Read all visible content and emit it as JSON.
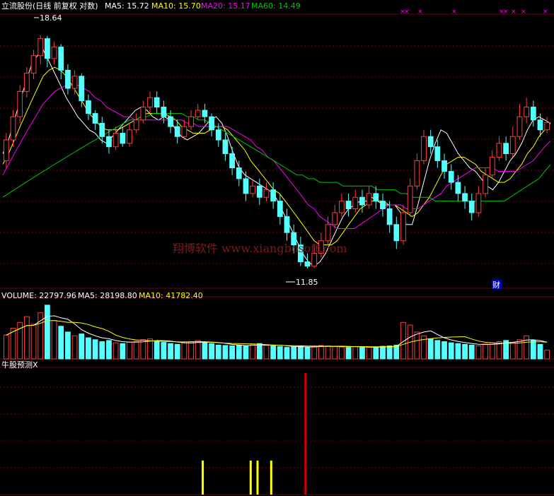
{
  "header_main": {
    "title": "立流股份(日线 前复权 对数)",
    "ma5_label": "MA5: 15.72",
    "ma10_label": "MA10: 15.70",
    "ma20_label": "MA20: 15.17",
    "ma60_label": "MA60: 14.49"
  },
  "annotations": {
    "high_marker": "18.64",
    "low_marker": "11.85",
    "cai_badge": "财",
    "watermark": "翔博软件 www.xiangbosoft.com",
    "x_marks": [
      "×",
      "×",
      "×",
      "×",
      "×",
      "×",
      "×",
      "×",
      "×"
    ]
  },
  "header_volume": {
    "volume_label": "VOLUME: 22797.96",
    "ma5_label": "MA5: 28198.80",
    "ma10_label": "MA10: 41782.40"
  },
  "header_indicator": {
    "title": "牛股预测X"
  },
  "colors": {
    "up": "#ff3c3c",
    "down": "#54ffff",
    "ma5": "#ffffff",
    "ma10": "#ffff00",
    "ma20": "#ff00ff",
    "ma60": "#00c800",
    "grid": "#7a0000",
    "signal_yellow": "#ffff00",
    "signal_red": "#c80000"
  },
  "chart_data": [
    {
      "type": "candlestick",
      "title": "立流股份(日线 前复权 对数)",
      "y_scale": "log",
      "ylim": [
        11.4,
        19.4
      ],
      "max_marker": 18.64,
      "min_marker": 11.85,
      "ma_latest": {
        "MA5": 15.72,
        "MA10": 15.7,
        "MA20": 15.17,
        "MA60": 14.49
      },
      "series": [
        {
          "name": "MA5",
          "values": [
            14.8,
            15.2,
            15.8,
            16.4,
            17.0,
            17.6,
            17.9,
            18.1,
            17.7,
            17.3,
            16.9,
            16.5,
            16.2,
            15.9,
            15.7,
            15.5,
            15.4,
            15.2,
            15.1,
            15.3,
            15.5,
            15.7,
            15.9,
            16.1,
            16.2,
            16.1,
            15.9,
            15.8,
            15.9,
            15.8,
            15.5,
            15.3,
            15.2,
            15.3,
            15.4,
            15.6,
            15.8,
            15.9,
            15.7,
            15.3,
            14.8,
            14.4,
            14.2,
            14.1,
            14.0,
            13.9,
            13.8,
            13.7,
            13.4,
            13.1,
            12.8,
            12.5,
            12.2,
            12.0,
            11.9,
            12.0,
            12.2,
            12.5,
            12.8,
            13.1,
            13.3,
            13.4,
            13.5,
            13.5,
            13.6,
            13.5,
            13.4,
            13.4,
            13.4,
            13.2,
            12.9,
            12.9,
            13.4,
            14.0,
            14.6,
            15.1,
            15.5,
            15.4,
            15.1,
            14.8,
            14.6,
            14.4,
            14.3,
            14.1,
            13.9,
            13.8,
            14.0,
            14.3,
            14.6,
            14.8,
            15.1,
            15.5,
            15.8,
            15.9,
            15.8,
            15.7
          ]
        },
        {
          "name": "MA10",
          "values": [
            14.5,
            14.8,
            15.2,
            15.6,
            16.0,
            16.4,
            16.8,
            17.2,
            17.4,
            17.5,
            17.4,
            17.2,
            16.9,
            16.6,
            16.3,
            16.0,
            15.8,
            15.6,
            15.5,
            15.5,
            15.5,
            15.6,
            15.7,
            15.8,
            15.9,
            16.0,
            16.0,
            16.0,
            16.0,
            15.9,
            15.8,
            15.6,
            15.5,
            15.4,
            15.4,
            15.4,
            15.5,
            15.6,
            15.6,
            15.5,
            15.3,
            15.1,
            14.9,
            14.6,
            14.4,
            14.2,
            14.0,
            13.8,
            13.7,
            13.5,
            13.3,
            13.1,
            12.9,
            12.7,
            12.5,
            12.4,
            12.4,
            12.4,
            12.5,
            12.7,
            12.9,
            13.1,
            13.3,
            13.4,
            13.5,
            13.5,
            13.5,
            13.4,
            13.4,
            13.3,
            13.2,
            13.1,
            13.2,
            13.4,
            13.6,
            13.9,
            14.2,
            14.5,
            14.6,
            14.7,
            14.7,
            14.6,
            14.5,
            14.3,
            14.2,
            14.1,
            14.0,
            14.0,
            14.1,
            14.3,
            14.5,
            14.8,
            15.0,
            15.3,
            15.5,
            15.7
          ]
        },
        {
          "name": "MA20",
          "values": [
            14.2,
            14.5,
            14.8,
            15.1,
            15.4,
            15.7,
            16.0,
            16.3,
            16.5,
            16.7,
            16.8,
            16.9,
            16.9,
            16.9,
            16.8,
            16.7,
            16.5,
            16.4,
            16.2,
            16.1,
            16.0,
            15.9,
            15.9,
            15.8,
            15.8,
            15.8,
            15.8,
            15.8,
            15.8,
            15.8,
            15.8,
            15.8,
            15.7,
            15.7,
            15.6,
            15.6,
            15.6,
            15.6,
            15.6,
            15.6,
            15.5,
            15.4,
            15.3,
            15.2,
            15.0,
            14.9,
            14.7,
            14.6,
            14.4,
            14.2,
            14.0,
            13.8,
            13.6,
            13.4,
            13.3,
            13.1,
            13.0,
            12.9,
            12.8,
            12.8,
            12.8,
            12.8,
            12.9,
            13.0,
            13.1,
            13.2,
            13.3,
            13.4,
            13.4,
            13.4,
            13.3,
            13.3,
            13.3,
            13.4,
            13.5,
            13.6,
            13.7,
            13.9,
            14.0,
            14.1,
            14.2,
            14.3,
            14.4,
            14.4,
            14.4,
            14.4,
            14.3,
            14.3,
            14.3,
            14.3,
            14.4,
            14.5,
            14.6,
            14.8,
            15.0,
            15.17
          ]
        },
        {
          "name": "MA60",
          "values": [
            13.6,
            13.7,
            13.8,
            13.9,
            14.0,
            14.1,
            14.2,
            14.3,
            14.4,
            14.5,
            14.6,
            14.7,
            14.8,
            14.9,
            15.0,
            15.1,
            15.2,
            15.3,
            15.4,
            15.5,
            15.6,
            15.7,
            15.8,
            15.8,
            15.9,
            15.9,
            16.0,
            16.0,
            16.0,
            16.0,
            16.0,
            16.0,
            15.9,
            15.9,
            15.8,
            15.8,
            15.7,
            15.6,
            15.5,
            15.4,
            15.3,
            15.2,
            15.1,
            15.0,
            14.9,
            14.8,
            14.7,
            14.6,
            14.5,
            14.4,
            14.3,
            14.2,
            14.2,
            14.1,
            14.1,
            14.0,
            14.0,
            14.0,
            14.0,
            13.9,
            13.9,
            13.9,
            13.9,
            13.9,
            13.9,
            13.8,
            13.8,
            13.8,
            13.8,
            13.7,
            13.7,
            13.6,
            13.6,
            13.6,
            13.6,
            13.5,
            13.5,
            13.5,
            13.5,
            13.5,
            13.5,
            13.5,
            13.5,
            13.5,
            13.5,
            13.5,
            13.5,
            13.5,
            13.6,
            13.7,
            13.8,
            13.9,
            14.0,
            14.1,
            14.3,
            14.49
          ]
        }
      ],
      "candles": [
        [
          14.6,
          15.2,
          15.4,
          14.4
        ],
        [
          15.2,
          15.9,
          16.1,
          15.0
        ],
        [
          15.9,
          16.7,
          16.9,
          15.7
        ],
        [
          16.7,
          17.3,
          17.5,
          16.5
        ],
        [
          17.3,
          17.9,
          18.1,
          17.1
        ],
        [
          17.9,
          18.5,
          18.64,
          17.6
        ],
        [
          18.5,
          17.8,
          18.6,
          17.5
        ],
        [
          17.8,
          18.2,
          18.4,
          17.6
        ],
        [
          18.2,
          17.4,
          18.3,
          17.1
        ],
        [
          17.4,
          16.8,
          17.6,
          16.6
        ],
        [
          16.8,
          17.2,
          17.4,
          16.6
        ],
        [
          17.2,
          16.4,
          17.3,
          16.2
        ],
        [
          16.4,
          16.0,
          16.6,
          15.8
        ],
        [
          16.0,
          15.7,
          16.1,
          15.5
        ],
        [
          15.7,
          15.3,
          15.9,
          15.1
        ],
        [
          15.3,
          15.0,
          15.5,
          14.8
        ],
        [
          15.0,
          15.4,
          15.6,
          14.9
        ],
        [
          15.4,
          15.1,
          15.6,
          15.0
        ],
        [
          15.1,
          15.5,
          15.7,
          15.0
        ],
        [
          15.5,
          15.8,
          16.0,
          15.4
        ],
        [
          15.8,
          16.2,
          16.4,
          15.7
        ],
        [
          16.2,
          16.5,
          16.7,
          16.0
        ],
        [
          16.5,
          16.2,
          16.7,
          16.0
        ],
        [
          16.2,
          15.9,
          16.4,
          15.7
        ],
        [
          15.9,
          15.6,
          16.1,
          15.4
        ],
        [
          15.6,
          15.3,
          15.8,
          15.1
        ],
        [
          15.3,
          15.6,
          15.8,
          15.2
        ],
        [
          15.6,
          15.9,
          16.1,
          15.5
        ],
        [
          15.9,
          16.1,
          16.3,
          15.8
        ],
        [
          16.1,
          15.9,
          16.3,
          15.7
        ],
        [
          15.9,
          15.5,
          16.0,
          15.3
        ],
        [
          15.5,
          15.2,
          15.7,
          15.0
        ],
        [
          15.2,
          14.8,
          15.4,
          14.6
        ],
        [
          14.8,
          14.4,
          15.0,
          14.2
        ],
        [
          14.4,
          14.1,
          14.6,
          13.9
        ],
        [
          14.1,
          13.7,
          14.3,
          13.5
        ],
        [
          13.7,
          13.9,
          14.1,
          13.6
        ],
        [
          13.9,
          13.6,
          14.1,
          13.4
        ],
        [
          13.6,
          13.8,
          14.0,
          13.5
        ],
        [
          13.8,
          13.5,
          14.0,
          13.3
        ],
        [
          13.5,
          13.1,
          13.7,
          12.9
        ],
        [
          13.1,
          12.7,
          13.3,
          12.5
        ],
        [
          12.7,
          12.4,
          12.9,
          12.2
        ],
        [
          12.4,
          12.0,
          12.6,
          11.9
        ],
        [
          12.0,
          11.9,
          12.2,
          11.85
        ],
        [
          11.9,
          12.2,
          12.4,
          11.85
        ],
        [
          12.2,
          12.5,
          12.7,
          12.1
        ],
        [
          12.5,
          12.9,
          13.1,
          12.4
        ],
        [
          12.9,
          13.2,
          13.4,
          12.8
        ],
        [
          13.2,
          13.5,
          13.7,
          13.1
        ],
        [
          13.5,
          13.3,
          13.7,
          13.1
        ],
        [
          13.3,
          13.6,
          13.8,
          13.2
        ],
        [
          13.6,
          13.4,
          13.8,
          13.2
        ],
        [
          13.4,
          13.7,
          13.9,
          13.3
        ],
        [
          13.7,
          13.5,
          13.9,
          13.3
        ],
        [
          13.5,
          13.3,
          13.7,
          13.1
        ],
        [
          13.3,
          12.9,
          13.5,
          12.7
        ],
        [
          12.9,
          12.5,
          13.1,
          12.3
        ],
        [
          12.5,
          13.2,
          13.4,
          12.4
        ],
        [
          13.2,
          13.9,
          14.1,
          13.1
        ],
        [
          13.9,
          14.6,
          14.8,
          13.8
        ],
        [
          14.6,
          15.3,
          15.5,
          14.5
        ],
        [
          15.3,
          15.0,
          15.5,
          14.8
        ],
        [
          15.0,
          14.6,
          15.2,
          14.4
        ],
        [
          14.6,
          14.3,
          14.8,
          14.1
        ],
        [
          14.3,
          14.0,
          14.5,
          13.8
        ],
        [
          14.0,
          13.7,
          14.2,
          13.5
        ],
        [
          13.7,
          13.5,
          13.9,
          13.3
        ],
        [
          13.5,
          13.2,
          13.7,
          13.0
        ],
        [
          13.2,
          13.7,
          13.9,
          13.1
        ],
        [
          13.7,
          14.2,
          14.4,
          13.6
        ],
        [
          14.2,
          14.7,
          14.9,
          14.1
        ],
        [
          14.7,
          15.1,
          15.3,
          14.6
        ],
        [
          15.1,
          14.8,
          15.3,
          14.6
        ],
        [
          14.8,
          15.3,
          15.6,
          14.7
        ],
        [
          15.3,
          15.9,
          16.3,
          15.2
        ],
        [
          15.9,
          16.2,
          16.5,
          15.7
        ],
        [
          16.2,
          15.8,
          16.4,
          15.6
        ],
        [
          15.8,
          15.5,
          16.0,
          15.3
        ],
        [
          15.5,
          15.72,
          15.9,
          15.4
        ]
      ]
    },
    {
      "type": "bar",
      "title": "VOLUME",
      "latest": {
        "VOLUME": 22797.96,
        "MA5": 28198.8,
        "MA10": 41782.4
      },
      "values": [
        62000,
        80000,
        95000,
        110000,
        90000,
        120000,
        140000,
        100000,
        85000,
        70000,
        60000,
        65000,
        55000,
        50000,
        45000,
        48000,
        42000,
        40000,
        44000,
        46000,
        50000,
        52000,
        47000,
        43000,
        40000,
        38000,
        42000,
        45000,
        48000,
        44000,
        40000,
        36000,
        35000,
        34000,
        36000,
        33000,
        38000,
        40000,
        35000,
        34000,
        32000,
        30000,
        31000,
        33000,
        30000,
        32000,
        35000,
        34000,
        33000,
        31000,
        30000,
        32000,
        31000,
        30000,
        29000,
        33000,
        34000,
        36000,
        95000,
        88000,
        70000,
        60000,
        52000,
        48000,
        45000,
        42000,
        40000,
        38000,
        36000,
        34000,
        39000,
        42000,
        45000,
        48000,
        43000,
        50000,
        60000,
        48000,
        38000,
        22797.96
      ]
    },
    {
      "type": "bar",
      "title": "牛股预测X",
      "signals": [
        {
          "index": 29,
          "color": "yellow",
          "value": 0.28
        },
        {
          "index": 36,
          "color": "yellow",
          "value": 0.28
        },
        {
          "index": 37,
          "color": "yellow",
          "value": 0.28
        },
        {
          "index": 39,
          "color": "yellow",
          "value": 0.28
        },
        {
          "index": 44,
          "color": "red",
          "value": 1.0
        }
      ]
    }
  ]
}
